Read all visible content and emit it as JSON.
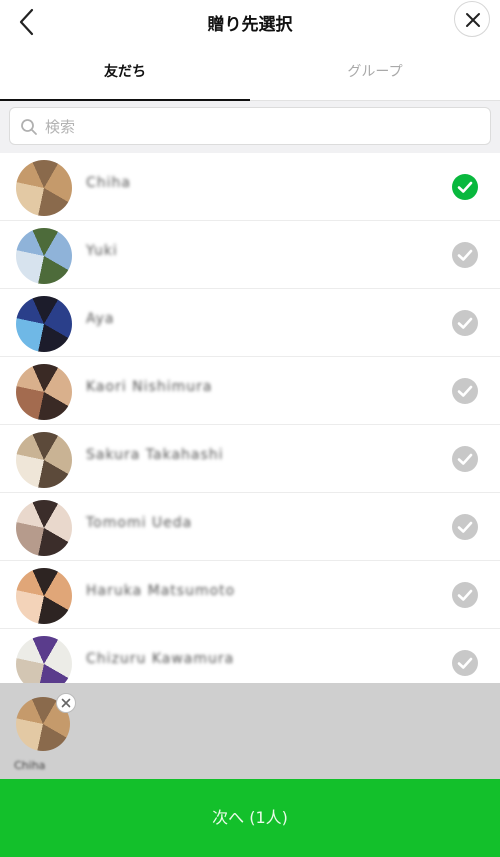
{
  "header": {
    "title": "贈り先選択",
    "back_icon": "chevron-left-icon",
    "close_icon": "close-icon"
  },
  "tabs": [
    {
      "label": "友だち",
      "active": true
    },
    {
      "label": "グループ",
      "active": false
    }
  ],
  "search": {
    "placeholder": "検索",
    "value": "",
    "icon": "search-icon"
  },
  "friends": [
    {
      "name": "Chiha",
      "selected": true,
      "avatar_colors": [
        "#c59a6b",
        "#8a6a4c",
        "#e3c9a4"
      ]
    },
    {
      "name": "Yuki",
      "selected": false,
      "avatar_colors": [
        "#8fb3d9",
        "#4d6b3a",
        "#d7e3ee"
      ]
    },
    {
      "name": "Aya",
      "selected": false,
      "avatar_colors": [
        "#2a3f8a",
        "#1c1c2b",
        "#6fb8e6"
      ]
    },
    {
      "name": "Kaori Nishimura",
      "selected": false,
      "avatar_colors": [
        "#d9b08c",
        "#3a2a25",
        "#a36b4f"
      ]
    },
    {
      "name": "Sakura Takahashi",
      "selected": false,
      "avatar_colors": [
        "#c9b394",
        "#5c4a3a",
        "#efe6d8"
      ]
    },
    {
      "name": "Tomomi Ueda",
      "selected": false,
      "avatar_colors": [
        "#e9d8cc",
        "#3b2d2a",
        "#b69b8c"
      ]
    },
    {
      "name": "Haruka Matsumoto",
      "selected": false,
      "avatar_colors": [
        "#e0a678",
        "#2d2422",
        "#f3d3b9"
      ]
    },
    {
      "name": "Chizuru Kawamura",
      "selected": false,
      "avatar_colors": [
        "#ecece7",
        "#5a3c8c",
        "#d3c6b3"
      ]
    }
  ],
  "selected_tray": [
    {
      "name": "Chiha",
      "avatar_colors": [
        "#c59a6b",
        "#8a6a4c",
        "#e3c9a4"
      ]
    }
  ],
  "next_button": {
    "label": "次へ (1人)"
  },
  "colors": {
    "accent_green": "#13c02b",
    "check_selected": "#09b83e",
    "check_unselected": "#c8c8c8",
    "tray_bg": "#cfcfcf"
  }
}
